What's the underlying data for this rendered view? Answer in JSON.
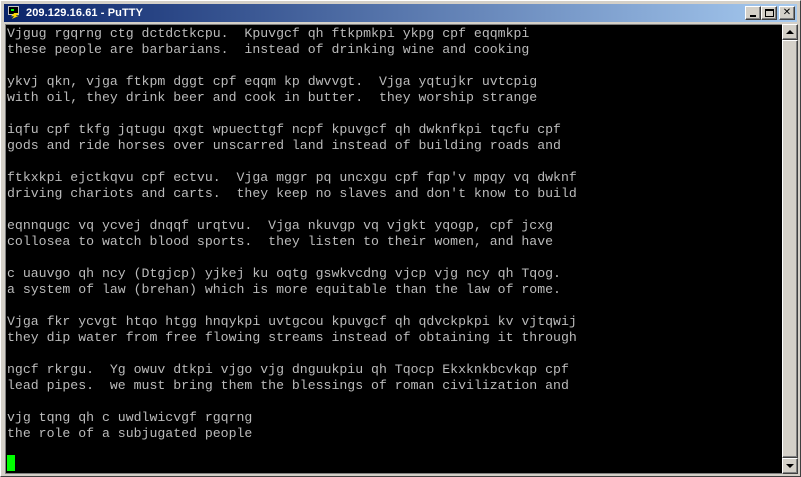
{
  "window": {
    "title": "209.129.16.61 - PuTTY",
    "icon": "putty-icon",
    "controls": [
      "minimize-icon",
      "maximize-icon",
      "close-icon"
    ],
    "close_glyph": "✕"
  },
  "terminal": {
    "background": "#000000",
    "foreground": "#bbbbbb",
    "cursor_color": "#00ff00",
    "lines": [
      "Vjgug rgqrng ctg dctdctkcpu.  Kpuvgcf qh ftkpmkpi ykpg cpf eqqmkpi",
      "these people are barbarians.  instead of drinking wine and cooking",
      "",
      "ykvj qkn, vjga ftkpm dggt cpf eqqm kp dwvvgt.  Vjga yqtujkr uvtcpig",
      "with oil, they drink beer and cook in butter.  they worship strange",
      "",
      "iqfu cpf tkfg jqtugu qxgt wpuecttgf ncpf kpuvgcf qh dwknfkpi tqcfu cpf",
      "gods and ride horses over unscarred land instead of building roads and",
      "",
      "ftkxkpi ejctkqvu cpf ectvu.  Vjga mggr pq uncxgu cpf fqp'v mpqy vq dwknf",
      "driving chariots and carts.  they keep no slaves and don't know to build",
      "",
      "eqnnqugc vq ycvej dnqqf urqtvu.  Vjga nkuvgp vq vjgkt yqogp, cpf jcxg",
      "collosea to watch blood sports.  they listen to their women, and have",
      "",
      "c uauvgo qh ncy (Dtgjcp) yjkej ku oqtg gswkvcdng vjcp vjg ncy qh Tqog.",
      "a system of law (brehan) which is more equitable than the law of rome.",
      "",
      "Vjga fkr ycvgt htqo htgg hnqykpi uvtgcou kpuvgcf qh qdvckpkpi kv vjtqwij",
      "they dip water from free flowing streams instead of obtaining it through",
      "",
      "ngcf rkrgu.  Yg owuv dtkpi vjgo vjg dnguukpiu qh Tqocp Ekxknkbcvkqp cpf",
      "lead pipes.  we must bring them the blessings of roman civilization and",
      "",
      "vjg tqng qh c uwdlwicvgf rgqrng",
      "the role of a subjugated people"
    ]
  }
}
